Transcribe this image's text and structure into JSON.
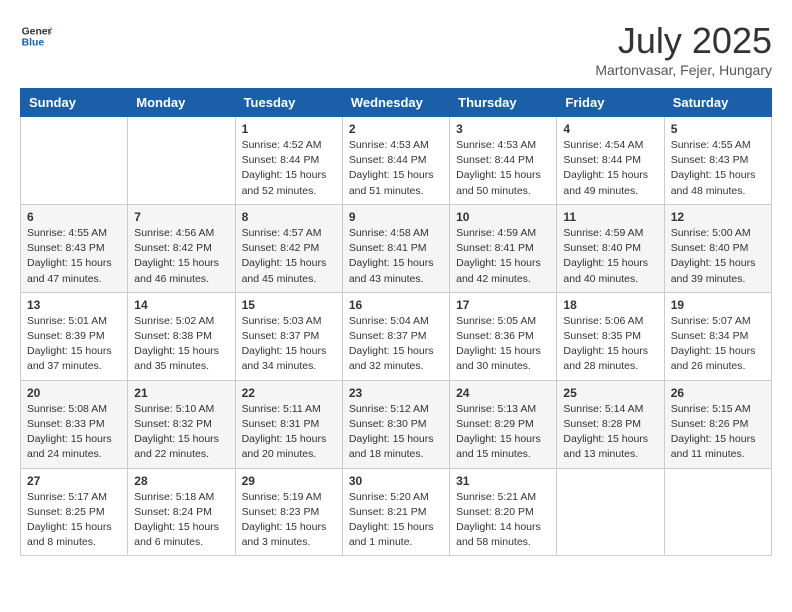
{
  "header": {
    "logo_general": "General",
    "logo_blue": "Blue",
    "month_title": "July 2025",
    "location": "Martonvasar, Fejer, Hungary"
  },
  "days_of_week": [
    "Sunday",
    "Monday",
    "Tuesday",
    "Wednesday",
    "Thursday",
    "Friday",
    "Saturday"
  ],
  "weeks": [
    [
      {
        "day": "",
        "info": ""
      },
      {
        "day": "",
        "info": ""
      },
      {
        "day": "1",
        "info": "Sunrise: 4:52 AM\nSunset: 8:44 PM\nDaylight: 15 hours\nand 52 minutes."
      },
      {
        "day": "2",
        "info": "Sunrise: 4:53 AM\nSunset: 8:44 PM\nDaylight: 15 hours\nand 51 minutes."
      },
      {
        "day": "3",
        "info": "Sunrise: 4:53 AM\nSunset: 8:44 PM\nDaylight: 15 hours\nand 50 minutes."
      },
      {
        "day": "4",
        "info": "Sunrise: 4:54 AM\nSunset: 8:44 PM\nDaylight: 15 hours\nand 49 minutes."
      },
      {
        "day": "5",
        "info": "Sunrise: 4:55 AM\nSunset: 8:43 PM\nDaylight: 15 hours\nand 48 minutes."
      }
    ],
    [
      {
        "day": "6",
        "info": "Sunrise: 4:55 AM\nSunset: 8:43 PM\nDaylight: 15 hours\nand 47 minutes."
      },
      {
        "day": "7",
        "info": "Sunrise: 4:56 AM\nSunset: 8:42 PM\nDaylight: 15 hours\nand 46 minutes."
      },
      {
        "day": "8",
        "info": "Sunrise: 4:57 AM\nSunset: 8:42 PM\nDaylight: 15 hours\nand 45 minutes."
      },
      {
        "day": "9",
        "info": "Sunrise: 4:58 AM\nSunset: 8:41 PM\nDaylight: 15 hours\nand 43 minutes."
      },
      {
        "day": "10",
        "info": "Sunrise: 4:59 AM\nSunset: 8:41 PM\nDaylight: 15 hours\nand 42 minutes."
      },
      {
        "day": "11",
        "info": "Sunrise: 4:59 AM\nSunset: 8:40 PM\nDaylight: 15 hours\nand 40 minutes."
      },
      {
        "day": "12",
        "info": "Sunrise: 5:00 AM\nSunset: 8:40 PM\nDaylight: 15 hours\nand 39 minutes."
      }
    ],
    [
      {
        "day": "13",
        "info": "Sunrise: 5:01 AM\nSunset: 8:39 PM\nDaylight: 15 hours\nand 37 minutes."
      },
      {
        "day": "14",
        "info": "Sunrise: 5:02 AM\nSunset: 8:38 PM\nDaylight: 15 hours\nand 35 minutes."
      },
      {
        "day": "15",
        "info": "Sunrise: 5:03 AM\nSunset: 8:37 PM\nDaylight: 15 hours\nand 34 minutes."
      },
      {
        "day": "16",
        "info": "Sunrise: 5:04 AM\nSunset: 8:37 PM\nDaylight: 15 hours\nand 32 minutes."
      },
      {
        "day": "17",
        "info": "Sunrise: 5:05 AM\nSunset: 8:36 PM\nDaylight: 15 hours\nand 30 minutes."
      },
      {
        "day": "18",
        "info": "Sunrise: 5:06 AM\nSunset: 8:35 PM\nDaylight: 15 hours\nand 28 minutes."
      },
      {
        "day": "19",
        "info": "Sunrise: 5:07 AM\nSunset: 8:34 PM\nDaylight: 15 hours\nand 26 minutes."
      }
    ],
    [
      {
        "day": "20",
        "info": "Sunrise: 5:08 AM\nSunset: 8:33 PM\nDaylight: 15 hours\nand 24 minutes."
      },
      {
        "day": "21",
        "info": "Sunrise: 5:10 AM\nSunset: 8:32 PM\nDaylight: 15 hours\nand 22 minutes."
      },
      {
        "day": "22",
        "info": "Sunrise: 5:11 AM\nSunset: 8:31 PM\nDaylight: 15 hours\nand 20 minutes."
      },
      {
        "day": "23",
        "info": "Sunrise: 5:12 AM\nSunset: 8:30 PM\nDaylight: 15 hours\nand 18 minutes."
      },
      {
        "day": "24",
        "info": "Sunrise: 5:13 AM\nSunset: 8:29 PM\nDaylight: 15 hours\nand 15 minutes."
      },
      {
        "day": "25",
        "info": "Sunrise: 5:14 AM\nSunset: 8:28 PM\nDaylight: 15 hours\nand 13 minutes."
      },
      {
        "day": "26",
        "info": "Sunrise: 5:15 AM\nSunset: 8:26 PM\nDaylight: 15 hours\nand 11 minutes."
      }
    ],
    [
      {
        "day": "27",
        "info": "Sunrise: 5:17 AM\nSunset: 8:25 PM\nDaylight: 15 hours\nand 8 minutes."
      },
      {
        "day": "28",
        "info": "Sunrise: 5:18 AM\nSunset: 8:24 PM\nDaylight: 15 hours\nand 6 minutes."
      },
      {
        "day": "29",
        "info": "Sunrise: 5:19 AM\nSunset: 8:23 PM\nDaylight: 15 hours\nand 3 minutes."
      },
      {
        "day": "30",
        "info": "Sunrise: 5:20 AM\nSunset: 8:21 PM\nDaylight: 15 hours\nand 1 minute."
      },
      {
        "day": "31",
        "info": "Sunrise: 5:21 AM\nSunset: 8:20 PM\nDaylight: 14 hours\nand 58 minutes."
      },
      {
        "day": "",
        "info": ""
      },
      {
        "day": "",
        "info": ""
      }
    ]
  ]
}
